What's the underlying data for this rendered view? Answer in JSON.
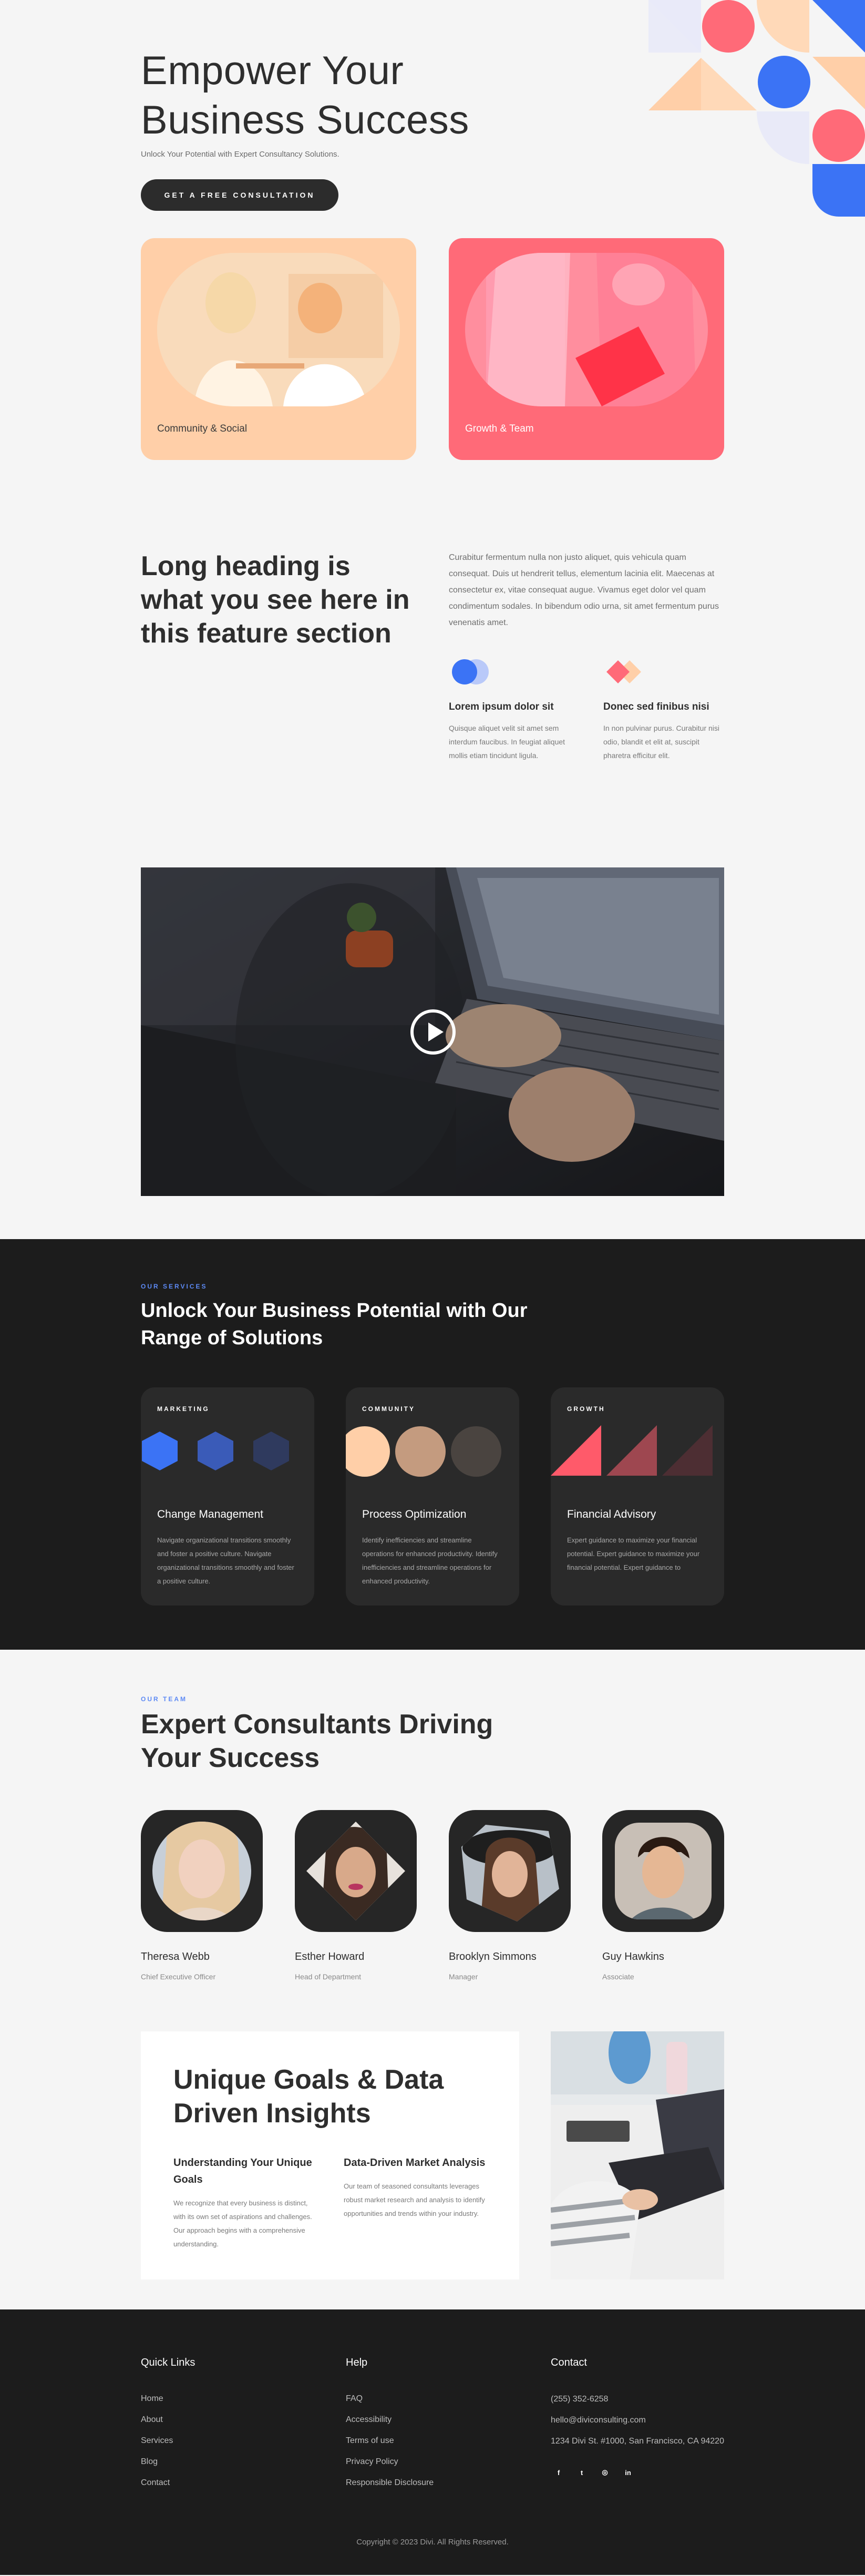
{
  "hero": {
    "title_line1": "Empower Your",
    "title_line2": "Business Success",
    "subtitle": "Unlock Your Potential with Expert Consultancy Solutions.",
    "cta_label": "GET A FREE CONSULTATION",
    "cards": [
      {
        "label": "Community & Social"
      },
      {
        "label": "Growth & Team"
      }
    ],
    "colors": {
      "peach": "#ffcfa8",
      "coral": "#ff6a78",
      "blue": "#3b73f5",
      "lavender": "#e9eaf8"
    }
  },
  "feature": {
    "heading": "Long heading is what you see here in this feature section",
    "paragraph": "Curabitur fermentum nulla non justo aliquet, quis vehicula quam consequat. Duis ut hendrerit tellus, elementum lacinia elit. Maecenas at consectetur ex, vitae consequat augue. Vivamus eget dolor vel quam condimentum sodales. In bibendum odio urna, sit amet fermentum purus venenatis amet.",
    "columns": [
      {
        "title": "Lorem ipsum dolor sit",
        "text": "Quisque aliquet velit sit amet sem interdum faucibus. In feugiat aliquet mollis etiam tincidunt ligula."
      },
      {
        "title": "Donec sed finibus nisi",
        "text": "In non pulvinar purus. Curabitur nisi odio, blandit et elit at, suscipit pharetra efficitur elit."
      }
    ]
  },
  "services": {
    "eyebrow": "OUR SERVICES",
    "title": "Unlock Your Business Potential with Our Range of Solutions",
    "cards": [
      {
        "tag": "MARKETING",
        "title": "Change Management",
        "text": "Navigate organizational transitions smoothly and foster a positive culture. Navigate organizational transitions smoothly and foster a positive culture."
      },
      {
        "tag": "COMMUNITY",
        "title": "Process Optimization",
        "text": "Identify inefficiencies and streamline operations for enhanced productivity. Identify inefficiencies and streamline operations for enhanced productivity."
      },
      {
        "tag": "GROWTH",
        "title": "Financial Advisory",
        "text": "Expert guidance to maximize your financial potential. Expert guidance to maximize your financial potential. Expert guidance to"
      }
    ]
  },
  "team": {
    "eyebrow": "OUR TEAM",
    "title": "Expert Consultants Driving Your Success",
    "members": [
      {
        "name": "Theresa Webb",
        "role": "Chief Executive Officer"
      },
      {
        "name": "Esther Howard",
        "role": "Head of Department"
      },
      {
        "name": "Brooklyn Simmons",
        "role": "Manager"
      },
      {
        "name": "Guy Hawkins",
        "role": "Associate"
      }
    ]
  },
  "goals": {
    "title": "Unique Goals & Data Driven Insights",
    "columns": [
      {
        "title": "Understanding Your Unique Goals",
        "text": "We recognize that every business is distinct, with its own set of aspirations and challenges. Our approach begins with a comprehensive understanding."
      },
      {
        "title": "Data-Driven Market Analysis",
        "text": "Our team of seasoned consultants leverages robust market research and analysis to identify opportunities and trends within your industry."
      }
    ]
  },
  "footer": {
    "quick_links_title": "Quick Links",
    "quick_links": [
      "Home",
      "About",
      "Services",
      "Blog",
      "Contact"
    ],
    "help_title": "Help",
    "help_links": [
      "FAQ",
      "Accessibility",
      "Terms of use",
      "Privacy Policy",
      "Responsible Disclosure"
    ],
    "contact_title": "Contact",
    "phone": "(255) 352-6258",
    "email": "hello@diviconsulting.com",
    "address": "1234 Divi St. #1000, San Francisco, CA 94220",
    "socials": [
      {
        "icon": "facebook-icon",
        "glyph": "f"
      },
      {
        "icon": "twitter-icon",
        "glyph": "t"
      },
      {
        "icon": "instagram-icon",
        "glyph": "◎"
      },
      {
        "icon": "linkedin-icon",
        "glyph": "in"
      }
    ],
    "copyright": "Copyright © 2023 Divi. All Rights Reserved."
  }
}
